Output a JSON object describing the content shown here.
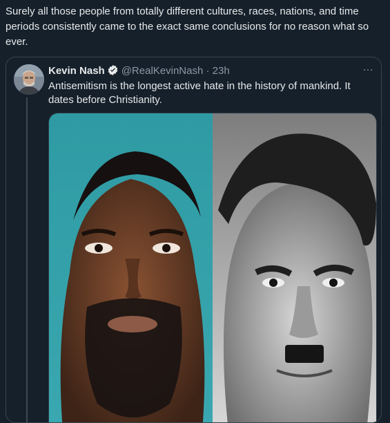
{
  "outer_tweet": {
    "text": "Surely all those people from totally different cultures, races, nations, and time periods consistently came to the exact same conclusions for no reason what so ever."
  },
  "quoted_tweet": {
    "name": "Kevin Nash",
    "handle": "@RealKevinNash",
    "separator": "·",
    "time": "23h",
    "more_icon": "…",
    "text": "Antisemitism is the longest active hate in the history of mankind. It dates before Christianity.",
    "verified_icon": "verified-badge-icon"
  },
  "colors": {
    "background": "#15202b",
    "text": "#e7e9ea",
    "secondary": "#8b98a5",
    "border": "#38444d"
  }
}
